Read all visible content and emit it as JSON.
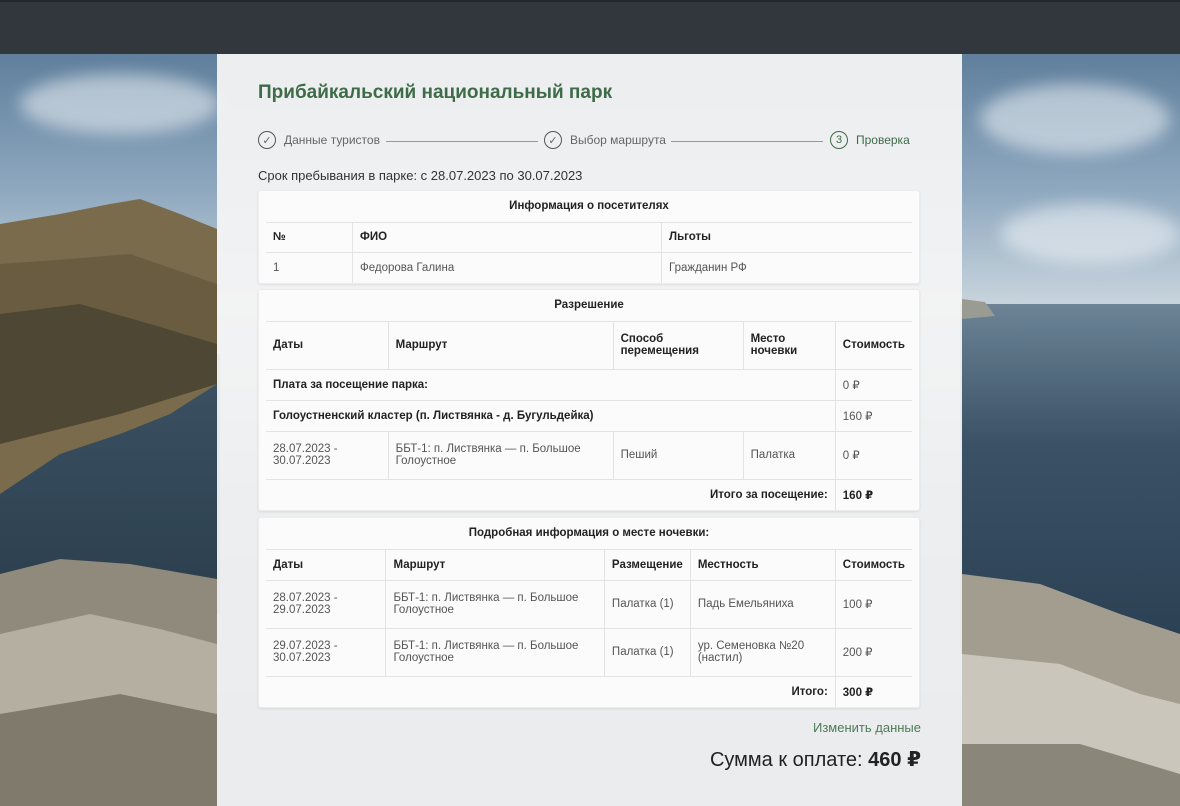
{
  "park_title": "Прибайкальский национальный парк",
  "stepper": {
    "steps": [
      {
        "label": "Данные туристов",
        "marker": "✓"
      },
      {
        "label": "Выбор маршрута",
        "marker": "✓"
      },
      {
        "label": "Проверка",
        "marker": "3"
      }
    ]
  },
  "stay_period": "Срок пребывания в парке: с 28.07.2023 по 30.07.2023",
  "visitors": {
    "caption": "Информация о посетителях",
    "headers": [
      "№",
      "ФИО",
      "Льготы"
    ],
    "rows": [
      {
        "num": "1",
        "name": "Федорова Галина",
        "benefit": "Гражданин РФ"
      }
    ]
  },
  "permit": {
    "caption": "Разрешение",
    "headers": [
      "Даты",
      "Маршрут",
      "Способ перемещения",
      "Место ночевки",
      "Стоимость"
    ],
    "fee_label": "Плата за посещение парка:",
    "fee_value": "0 ₽",
    "cluster_label": "Голоустненский кластер (п. Листвянка - д. Бугульдейка)",
    "cluster_value": "160 ₽",
    "rows": [
      {
        "dates": "28.07.2023 - 30.07.2023",
        "route": "ББТ-1: п. Листвянка — п. Большое Голоустное",
        "transport": "Пеший",
        "overnight": "Палатка",
        "cost": "0 ₽"
      }
    ],
    "total_label": "Итого за посещение:",
    "total_value": "160 ₽"
  },
  "overnight": {
    "caption": "Подробная информация о месте ночевки:",
    "headers": [
      "Даты",
      "Маршрут",
      "Размещение",
      "Местность",
      "Стоимость"
    ],
    "rows": [
      {
        "dates": "28.07.2023 - 29.07.2023",
        "route": "ББТ-1: п. Листвянка — п. Большое Голоустное",
        "placement": "Палатка (1)",
        "area": "Падь Емельяниха",
        "cost": "100 ₽"
      },
      {
        "dates": "29.07.2023 - 30.07.2023",
        "route": "ББТ-1: п. Листвянка — п. Большое Голоустное",
        "placement": "Палатка (1)",
        "area": "ур. Семеновка №20 (настил)",
        "cost": "200 ₽"
      }
    ],
    "total_label": "Итого:",
    "total_value": "300 ₽"
  },
  "edit_link": "Изменить данные",
  "payment": {
    "label": "Сумма к оплате:",
    "value": "460 ₽"
  },
  "colors": {
    "accent": "#3e6b48",
    "topbar": "#32363d"
  }
}
